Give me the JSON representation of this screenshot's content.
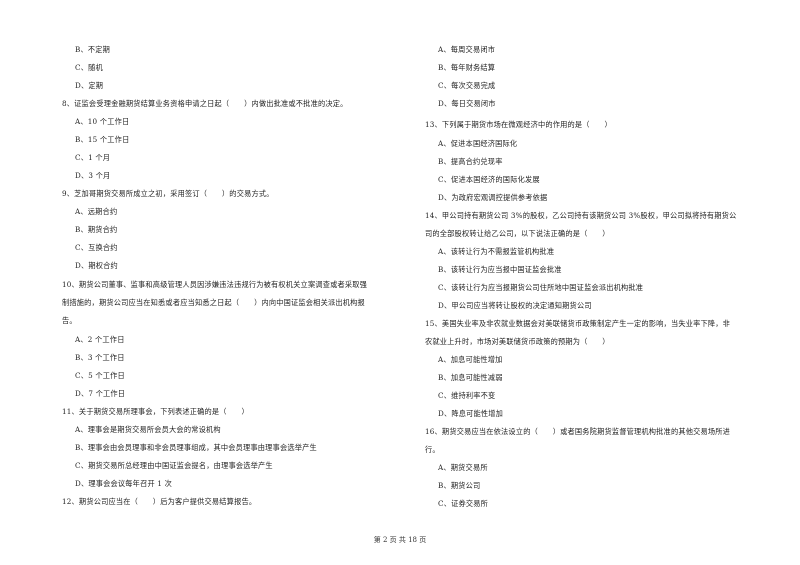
{
  "page": {
    "footer": "第 2 页 共 18 页"
  },
  "left_column": {
    "q7_tail_options": [
      "B、不定期",
      "C、随机",
      "D、定期"
    ],
    "q8": {
      "stem": "8、证监会受理金融期货结算业务资格申请之日起（　　）内做出批准或不批准的决定。",
      "options": [
        "A、10 个工作日",
        "B、15 个工作日",
        "C、1 个月",
        "D、3 个月"
      ]
    },
    "q9": {
      "stem": "9、芝加哥期货交易所成立之初，采用签订（　　）的交易方式。",
      "options": [
        "A、远期合约",
        "B、期货合约",
        "C、互换合约",
        "D、期权合约"
      ]
    },
    "q10": {
      "stem_lines": [
        "10、期货公司董事、监事和高级管理人员因涉嫌违法违规行为被有权机关立案调查或者采取强",
        "制措施的，期货公司应当在知悉或者应当知悉之日起（　　）内向中国证监会相关派出机构报",
        "告。"
      ],
      "options": [
        "A、2 个工作日",
        "B、3 个工作日",
        "C、5 个工作日",
        "D、7 个工作日"
      ]
    },
    "q11": {
      "stem": "11、关于期货交易所理事会，下列表述正确的是（　　）",
      "options": [
        "A、理事会是期货交易所会员大会的常设机构",
        "B、理事会由会员理事和非会员理事组成，其中会员理事由理事会选举产生",
        "C、期货交易所总经理由中国证监会提名，由理事会选举产生",
        "D、理事会会议每年召开 1 次"
      ]
    },
    "q12": {
      "stem": "12、期货公司应当在（　　）后为客户提供交易结算报告。"
    }
  },
  "right_column": {
    "q12_options": [
      "A、每周交易闭市",
      "B、每年财务结算",
      "C、每次交易完成",
      "D、每日交易闭市"
    ],
    "q13": {
      "stem": "13、下列属于期货市场在微观经济中的作用的是（　　）",
      "options": [
        "A、促进本国经济国际化",
        "B、提高合约兑现率",
        "C、促进本国经济的国际化发展",
        "D、为政府宏观调控提供参考依据"
      ]
    },
    "q14": {
      "stem_lines": [
        "14、甲公司持有期货公司 3%的股权，乙公司持有该期货公司 3%股权，甲公司拟将持有期货公",
        "司的全部股权转让给乙公司，以下说法正确的是（　　）"
      ],
      "options": [
        "A、该转让行为不需报监管机构批准",
        "B、该转让行为应当报中国证监会批准",
        "C、该转让行为应当报期货公司住所地中国证监会派出机构批准",
        "D、甲公司应当将转让股权的决定通知期货公司"
      ]
    },
    "q15": {
      "stem_lines": [
        "15、美国失业率及非农就业数据会对美联储货币政策制定产生一定的影响，当失业率下降，非",
        "农就业上升时，市场对美联储货币政策的预期为（　　）"
      ],
      "options": [
        "A、加息可能性增加",
        "B、加息可能性减弱",
        "C、维持利率不变",
        "D、降息可能性增加"
      ]
    },
    "q16": {
      "stem_lines": [
        "16、期货交易应当在依法设立的（　　）或者国务院期货监督管理机构批准的其他交易场所进",
        "行。"
      ],
      "options": [
        "A、期货交易所",
        "B、期货公司",
        "C、证券交易所"
      ]
    }
  }
}
